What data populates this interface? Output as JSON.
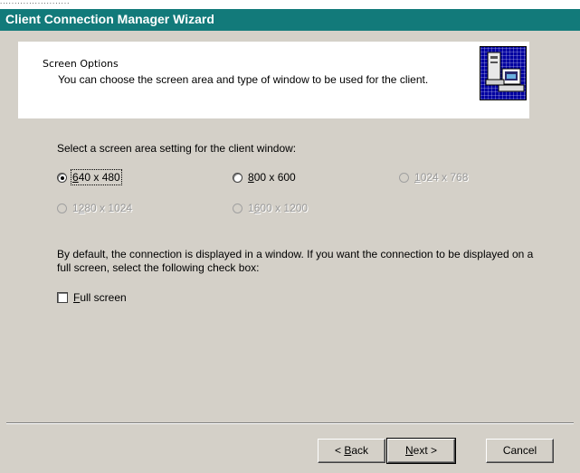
{
  "window": {
    "title": "Client Connection Manager Wizard",
    "top_fragment": "........................"
  },
  "header": {
    "title": "Screen Options",
    "subtitle": "You can choose the screen area and type of window to be used for the client."
  },
  "screen_area": {
    "prompt": "Select a screen area setting for the client window:",
    "options": [
      {
        "accel": "6",
        "rest": "40 x 480",
        "checked": true,
        "enabled": true
      },
      {
        "accel": "8",
        "rest": "00 x 600",
        "checked": false,
        "enabled": true
      },
      {
        "accel": "1",
        "rest": "024 x 768",
        "checked": false,
        "enabled": false
      },
      {
        "pre": "1",
        "accel": "2",
        "rest": "80 x 1024",
        "checked": false,
        "enabled": false
      },
      {
        "pre": "1",
        "accel": "6",
        "rest": "00 x 1200",
        "checked": false,
        "enabled": false
      }
    ]
  },
  "fullscreen": {
    "description": "By default, the connection is displayed in a window. If you want the connection to be displayed on a full screen, select the following check box:",
    "checkbox_accel": "F",
    "checkbox_rest": "ull screen",
    "checked": false
  },
  "buttons": {
    "back_prefix": "< ",
    "back_accel": "B",
    "back_rest": "ack",
    "next_accel": "N",
    "next_rest": "ext >",
    "cancel": "Cancel"
  },
  "colors": {
    "titlebar": "#127a7a",
    "dialog": "#d4d0c8",
    "icon_bg": "#0000a0"
  },
  "icons": [
    "wizard-computer-icon"
  ]
}
